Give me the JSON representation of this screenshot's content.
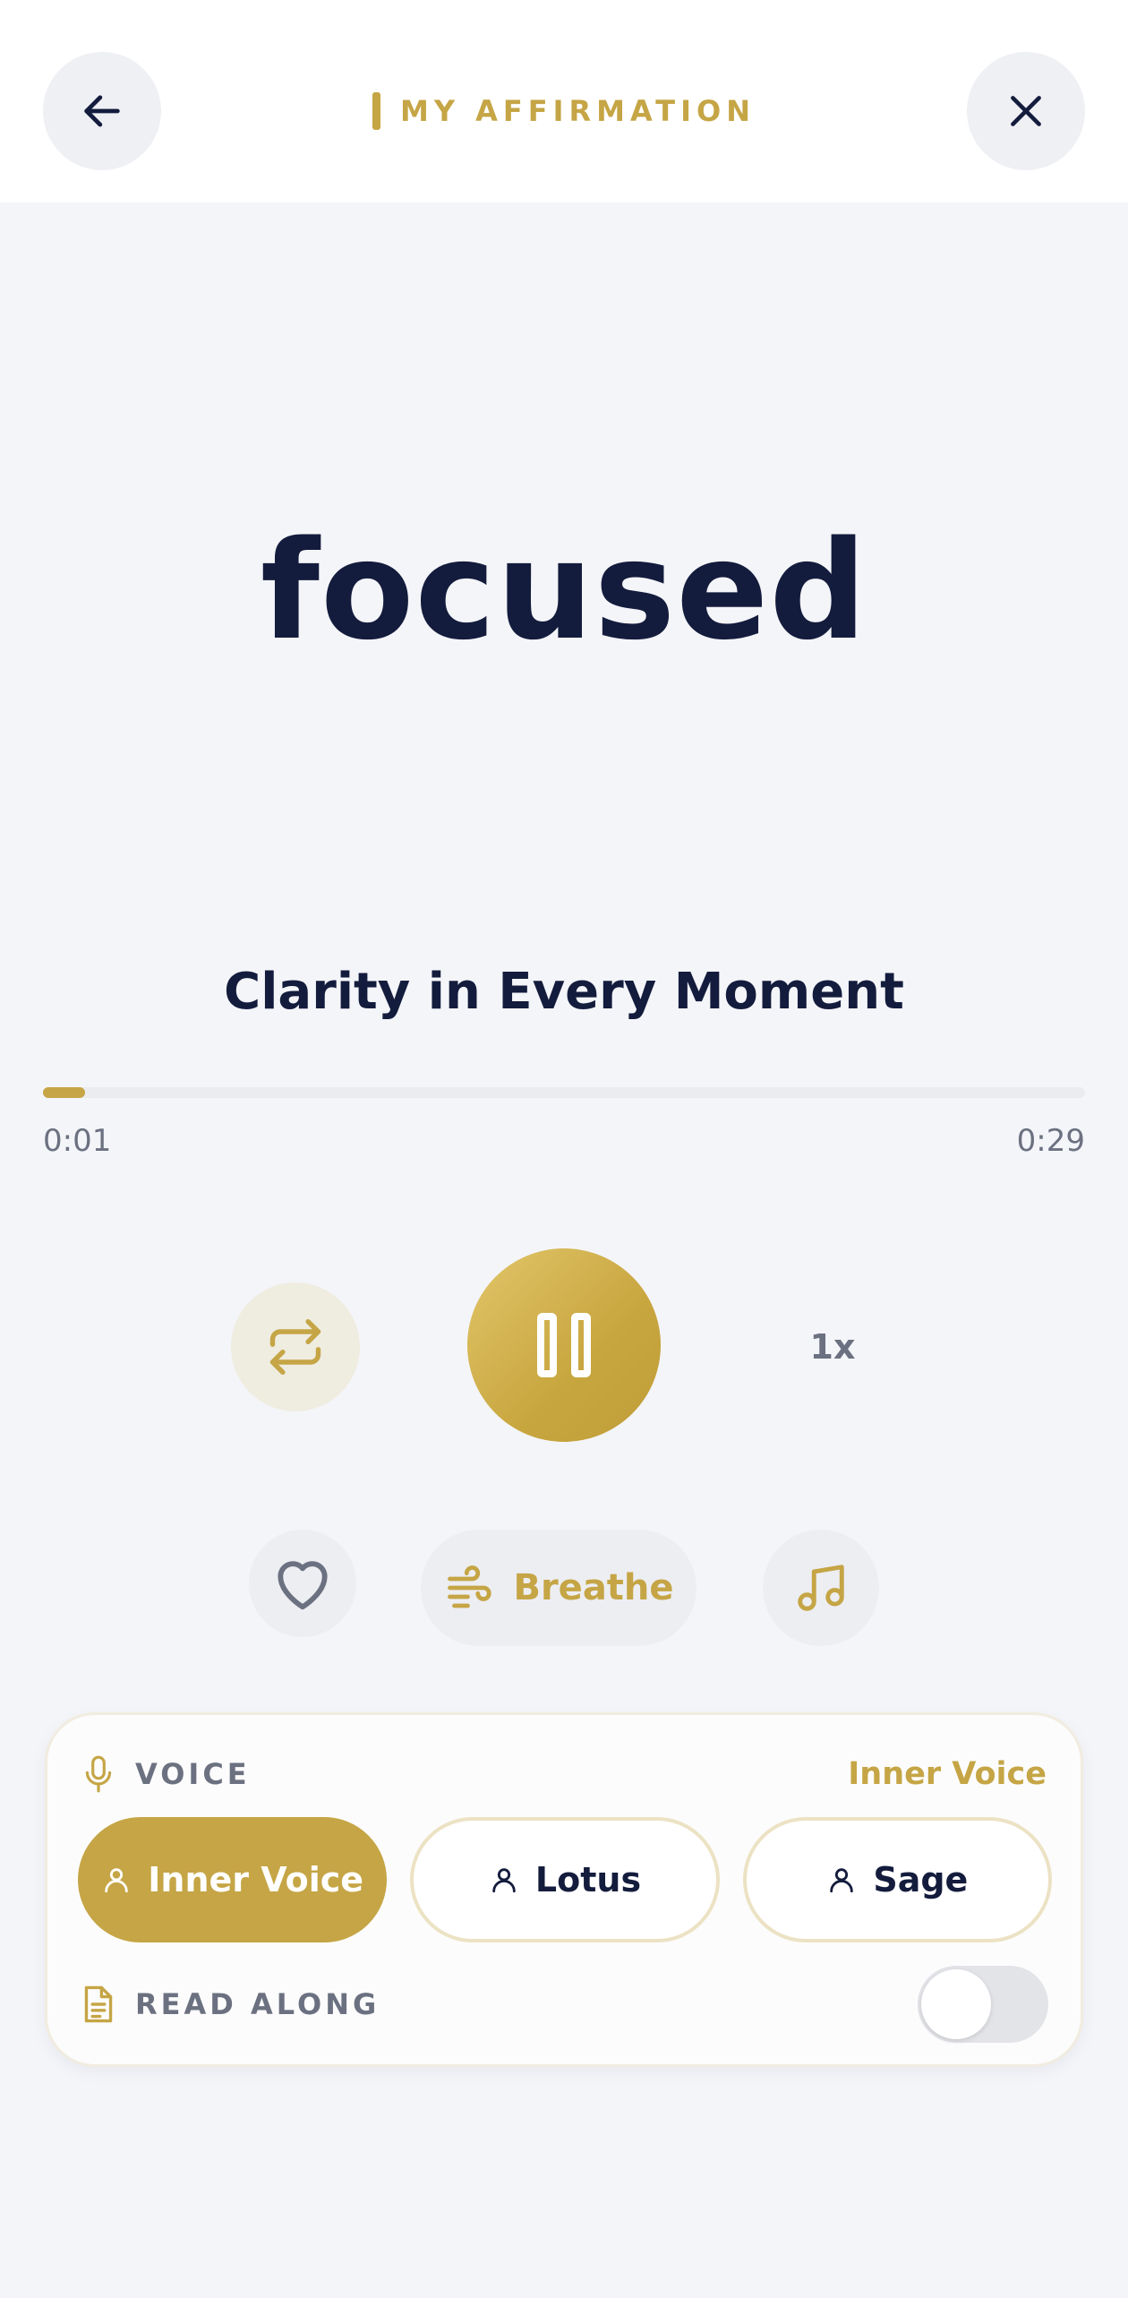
{
  "header": {
    "title": "MY AFFIRMATION",
    "back_icon": "arrow-left-icon",
    "close_icon": "close-icon"
  },
  "affirmation": {
    "word": "focused",
    "track_title": "Clarity in Every Moment"
  },
  "player": {
    "current_time": "0:01",
    "total_time": "0:29",
    "progress_fraction": 0.04,
    "speed_label": "1x",
    "state": "playing"
  },
  "actions": {
    "breathe_label": "Breathe"
  },
  "voice": {
    "section_label": "VOICE",
    "selected": "Inner Voice",
    "options": [
      {
        "label": "Inner Voice",
        "active": true
      },
      {
        "label": "Lotus",
        "active": false
      },
      {
        "label": "Sage",
        "active": false
      }
    ]
  },
  "read_along": {
    "label": "READ ALONG",
    "enabled": false
  },
  "colors": {
    "accent": "#c5a545",
    "text_dark": "#141c3d",
    "muted": "#6b7180",
    "background": "#f4f5f9"
  }
}
